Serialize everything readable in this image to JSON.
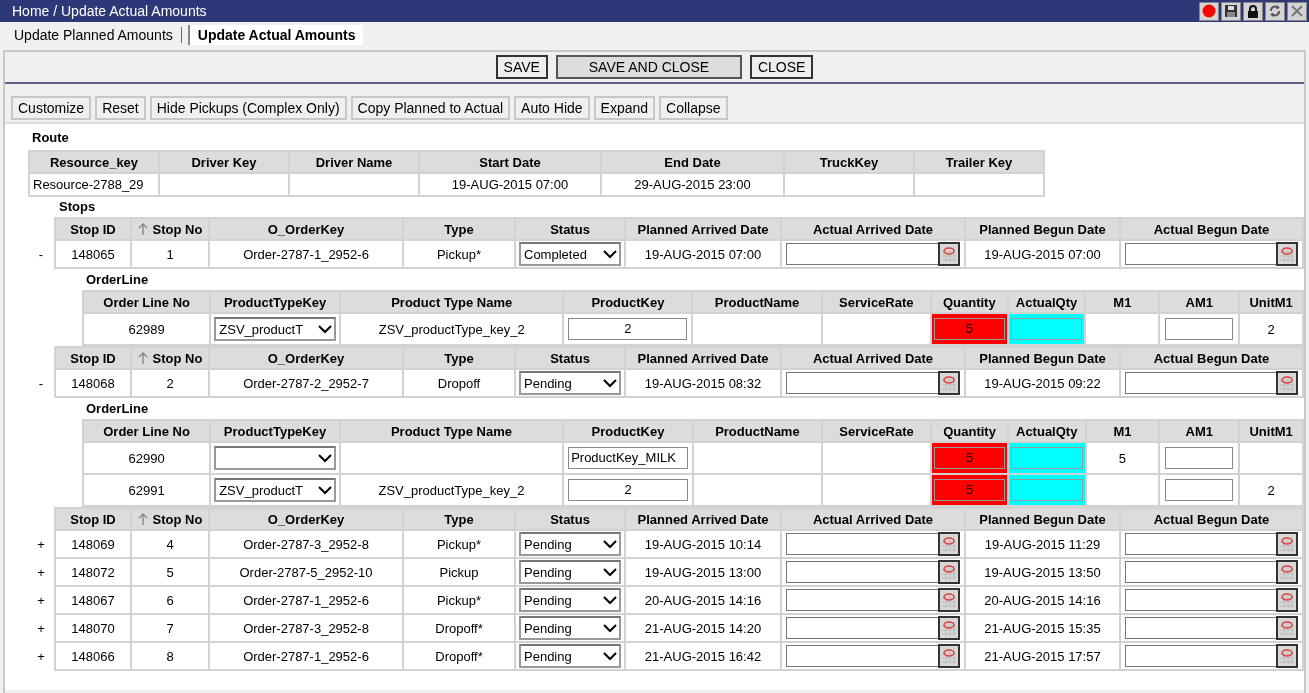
{
  "window": {
    "title": "Home / Update Actual Amounts"
  },
  "tabs": [
    {
      "label": "Update Planned Amounts",
      "selected": false
    },
    {
      "label": "Update Actual Amounts",
      "selected": true
    }
  ],
  "actions": [
    "SAVE",
    "SAVE AND CLOSE",
    "CLOSE"
  ],
  "toolbar": [
    "Customize",
    "Reset",
    "Hide Pickups (Complex Only)",
    "Copy Planned to Actual",
    "Auto Hide",
    "Expand",
    "Collapse"
  ],
  "route": {
    "title": "Route",
    "columns": [
      "Resource_key",
      "Driver Key",
      "Driver Name",
      "Start Date",
      "End Date",
      "TruckKey",
      "Trailer Key"
    ],
    "rows": [
      {
        "resource_key": "Resource-2788_29",
        "start_date": "19-AUG-2015 07:00",
        "end_date": "29-AUG-2015 23:00"
      }
    ]
  },
  "stops": {
    "title": "Stops",
    "tables": [
      {
        "columns": [
          {
            "label": "Stop ID",
            "sorted": false
          },
          {
            "label": "Stop No",
            "sorted": true
          },
          {
            "label": "O_OrderKey",
            "sorted": false
          },
          {
            "label": "Type",
            "sorted": false
          },
          {
            "label": "Status",
            "sorted": false
          },
          {
            "label": "Planned Arrived Date",
            "sorted": false
          },
          {
            "label": "Actual Arrived Date",
            "sorted": false
          },
          {
            "label": "Planned Begun Date",
            "sorted": false
          },
          {
            "label": "Actual Begun Date",
            "sorted": false
          }
        ],
        "rows": [
          {
            "toggle": "-",
            "stop_id": "148065",
            "stop_no": "1",
            "order_key": "Order-2787-1_2952-6",
            "type": "Pickup*",
            "status": "Completed",
            "planned_arrived": "19-AUG-2015 07:00",
            "planned_begun": "19-AUG-2015 07:00"
          }
        ],
        "order_line": {
          "title": "OrderLine",
          "columns": [
            "Order Line No",
            "ProductTypeKey",
            "Product Type Name",
            "ProductKey",
            "ProductName",
            "ServiceRate",
            "Quantity",
            "ActualQty",
            "M1",
            "AM1",
            "UnitM1"
          ],
          "rows": [
            {
              "line_no": "62989",
              "product_type_key": "ZSV_productT",
              "product_type_name": "ZSV_productType_key_2",
              "product_key": "2",
              "quantity": "5",
              "unit_m1": "2"
            }
          ]
        }
      },
      {
        "columns": [
          {
            "label": "Stop ID",
            "sorted": false
          },
          {
            "label": "Stop No",
            "sorted": true
          },
          {
            "label": "O_OrderKey",
            "sorted": false
          },
          {
            "label": "Type",
            "sorted": false
          },
          {
            "label": "Status",
            "sorted": false
          },
          {
            "label": "Planned Arrived Date",
            "sorted": false
          },
          {
            "label": "Actual Arrived Date",
            "sorted": false
          },
          {
            "label": "Planned Begun Date",
            "sorted": false
          },
          {
            "label": "Actual Begun Date",
            "sorted": false
          }
        ],
        "rows": [
          {
            "toggle": "-",
            "stop_id": "148068",
            "stop_no": "2",
            "order_key": "Order-2787-2_2952-7",
            "type": "Dropoff",
            "status": "Pending",
            "planned_arrived": "19-AUG-2015 08:32",
            "planned_begun": "19-AUG-2015 09:22"
          }
        ],
        "order_line": {
          "title": "OrderLine",
          "columns": [
            "Order Line No",
            "ProductTypeKey",
            "Product Type Name",
            "ProductKey",
            "ProductName",
            "ServiceRate",
            "Quantity",
            "ActualQty",
            "M1",
            "AM1",
            "UnitM1"
          ],
          "rows": [
            {
              "line_no": "62990",
              "product_key": "ProductKey_MILK",
              "quantity": "5",
              "m1": "5"
            },
            {
              "line_no": "62991",
              "product_type_key": "ZSV_productT",
              "product_type_name": "ZSV_productType_key_2",
              "product_key": "2",
              "quantity": "5",
              "unit_m1": "2"
            }
          ]
        }
      },
      {
        "columns": [
          {
            "label": "Stop ID",
            "sorted": false
          },
          {
            "label": "Stop No",
            "sorted": true
          },
          {
            "label": "O_OrderKey",
            "sorted": false
          },
          {
            "label": "Type",
            "sorted": false
          },
          {
            "label": "Status",
            "sorted": false
          },
          {
            "label": "Planned Arrived Date",
            "sorted": false
          },
          {
            "label": "Actual Arrived Date",
            "sorted": false
          },
          {
            "label": "Planned Begun Date",
            "sorted": false
          },
          {
            "label": "Actual Begun Date",
            "sorted": false
          }
        ],
        "rows": [
          {
            "toggle": "+",
            "stop_id": "148069",
            "stop_no": "4",
            "order_key": "Order-2787-3_2952-8",
            "type": "Pickup*",
            "status": "Pending",
            "planned_arrived": "19-AUG-2015 10:14",
            "planned_begun": "19-AUG-2015 11:29"
          },
          {
            "toggle": "+",
            "stop_id": "148072",
            "stop_no": "5",
            "order_key": "Order-2787-5_2952-10",
            "type": "Pickup",
            "status": "Pending",
            "planned_arrived": "19-AUG-2015 13:00",
            "planned_begun": "19-AUG-2015 13:50"
          },
          {
            "toggle": "+",
            "stop_id": "148067",
            "stop_no": "6",
            "order_key": "Order-2787-1_2952-6",
            "type": "Pickup*",
            "status": "Pending",
            "planned_arrived": "20-AUG-2015 14:16",
            "planned_begun": "20-AUG-2015 14:16"
          },
          {
            "toggle": "+",
            "stop_id": "148070",
            "stop_no": "7",
            "order_key": "Order-2787-3_2952-8",
            "type": "Dropoff*",
            "status": "Pending",
            "planned_arrived": "21-AUG-2015 14:20",
            "planned_begun": "21-AUG-2015 15:35"
          },
          {
            "toggle": "+",
            "stop_id": "148066",
            "stop_no": "8",
            "order_key": "Order-2787-1_2952-6",
            "type": "Dropoff*",
            "status": "Pending",
            "planned_arrived": "21-AUG-2015 16:42",
            "planned_begun": "21-AUG-2015 17:57"
          }
        ]
      }
    ]
  }
}
